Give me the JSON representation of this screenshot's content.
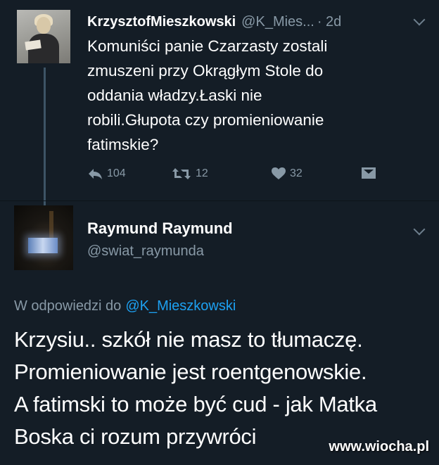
{
  "tweet": {
    "author_name": "KrzysztofMieszkowski",
    "author_handle": "@K_Mies...",
    "time": "· 2d",
    "text_lines": [
      "Komuniści panie Czarzasty zostali",
      "zmuszeni przy Okrągłym Stole do",
      "oddania władzy.Łaski nie",
      "robili.Głupota czy promieniowanie",
      "fatimskie?"
    ],
    "actions": {
      "reply_count": "104",
      "retweet_count": "12",
      "like_count": "32"
    },
    "icons": [
      "reply-icon",
      "retweet-icon",
      "heart-icon",
      "direct-message-icon",
      "chevron-down-icon"
    ]
  },
  "reply": {
    "author_name": "Raymund Raymund",
    "author_handle": "@swiat_raymunda",
    "in_reply_to_label": "W odpowiedzi do",
    "in_reply_to_handle": "@K_Mieszkowski",
    "text_lines": [
      "Krzysiu.. szkół nie masz  to tłumaczę.",
      "Promieniowanie jest roentgenowskie.",
      "A fatimski to może być cud - jak Matka",
      "Boska ci rozum przywróci"
    ]
  },
  "watermark": "www.wiocha.pl",
  "colors": {
    "background": "#141d26",
    "secondary_text": "#8899a6",
    "link": "#1da1f2"
  }
}
